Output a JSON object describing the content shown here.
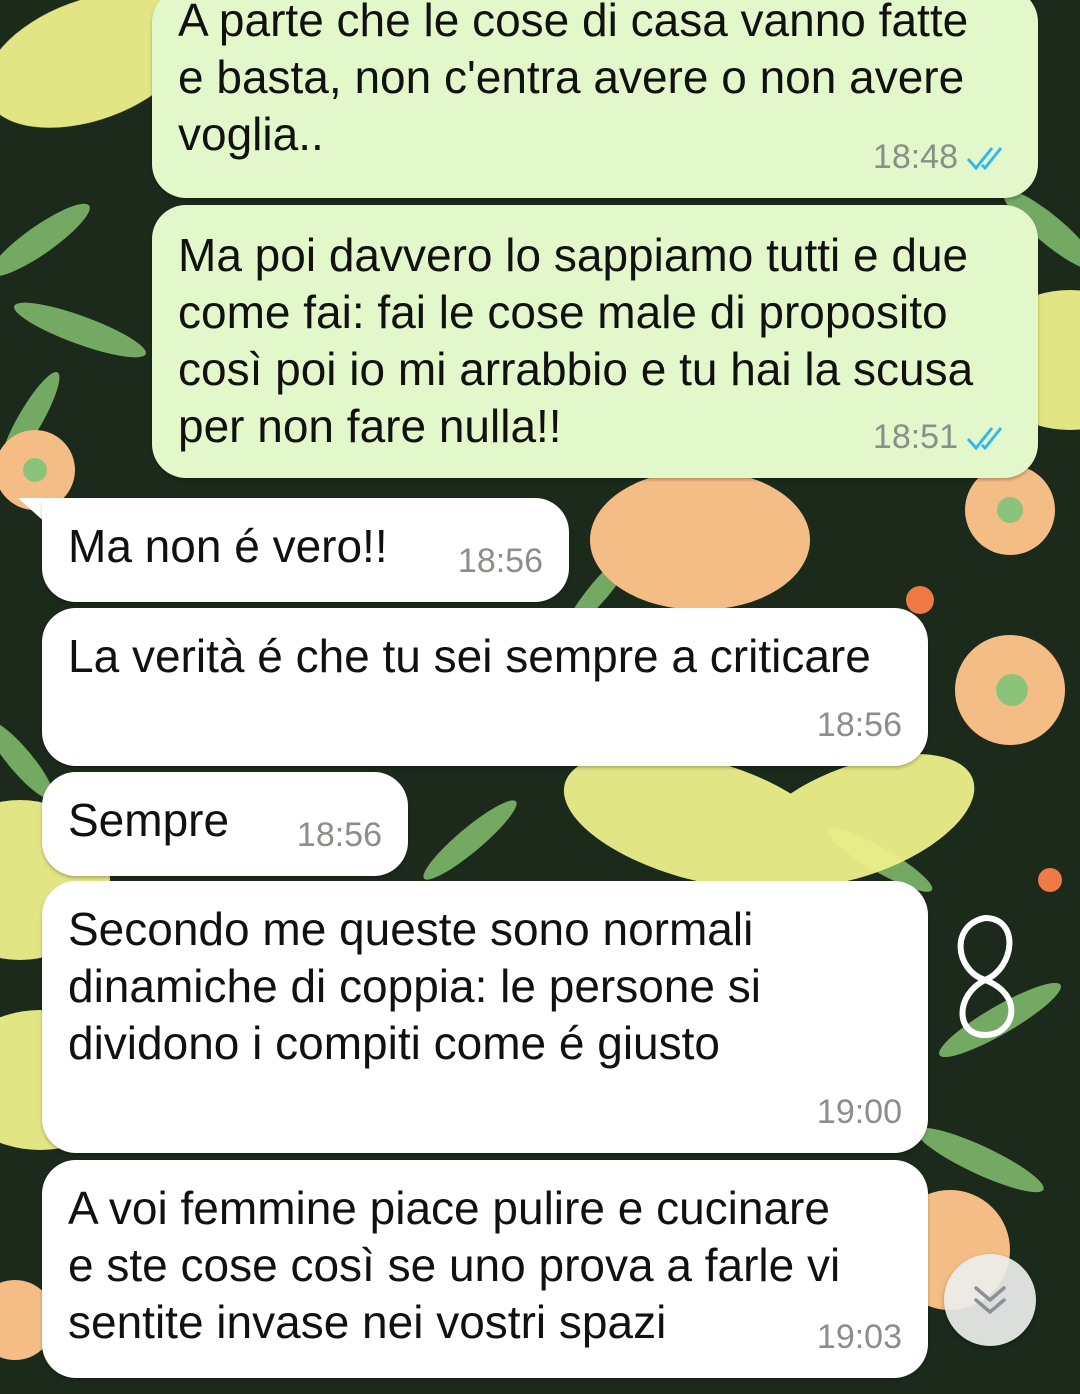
{
  "chat": {
    "messages": [
      {
        "direction": "out",
        "text": "A parte che le cose di casa vanno fatte\ne basta, non c'entra avere o non avere\nvoglia..",
        "time": "18:48",
        "status": "read"
      },
      {
        "direction": "out",
        "text": "Ma poi davvero lo sappiamo tutti e due\ncome fai: fai le cose male di proposito\ncosì poi io mi arrabbio e tu hai la scusa\nper non fare nulla!!",
        "time": "18:51",
        "status": "read"
      },
      {
        "direction": "in",
        "text": "Ma non é vero!!",
        "time": "18:56"
      },
      {
        "direction": "in",
        "text": "La verità é che tu sei sempre a criticare",
        "time": "18:56"
      },
      {
        "direction": "in",
        "text": "Sempre",
        "time": "18:56"
      },
      {
        "direction": "in",
        "text": "Secondo me queste sono normali\ndinamiche di coppia: le persone si\ndividono i compiti come é giusto",
        "time": "19:00"
      },
      {
        "direction": "in",
        "text": "A voi femmine piace pulire e cucinare\ne ste cose così se uno prova a farle vi\nsentite invase nei vostri spazi",
        "time": "19:03"
      }
    ]
  },
  "scroll_button": {
    "icon": "double-chevron-down-icon"
  },
  "colors": {
    "outgoing_bubble": "#e2f8ca",
    "incoming_bubble": "#ffffff",
    "read_ticks": "#34b7f1",
    "wallpaper_dark": "#1c2a1c",
    "wallpaper_yellow": "#eef08a",
    "wallpaper_peach": "#f5bd86",
    "wallpaper_leaf": "#8cc37a"
  }
}
